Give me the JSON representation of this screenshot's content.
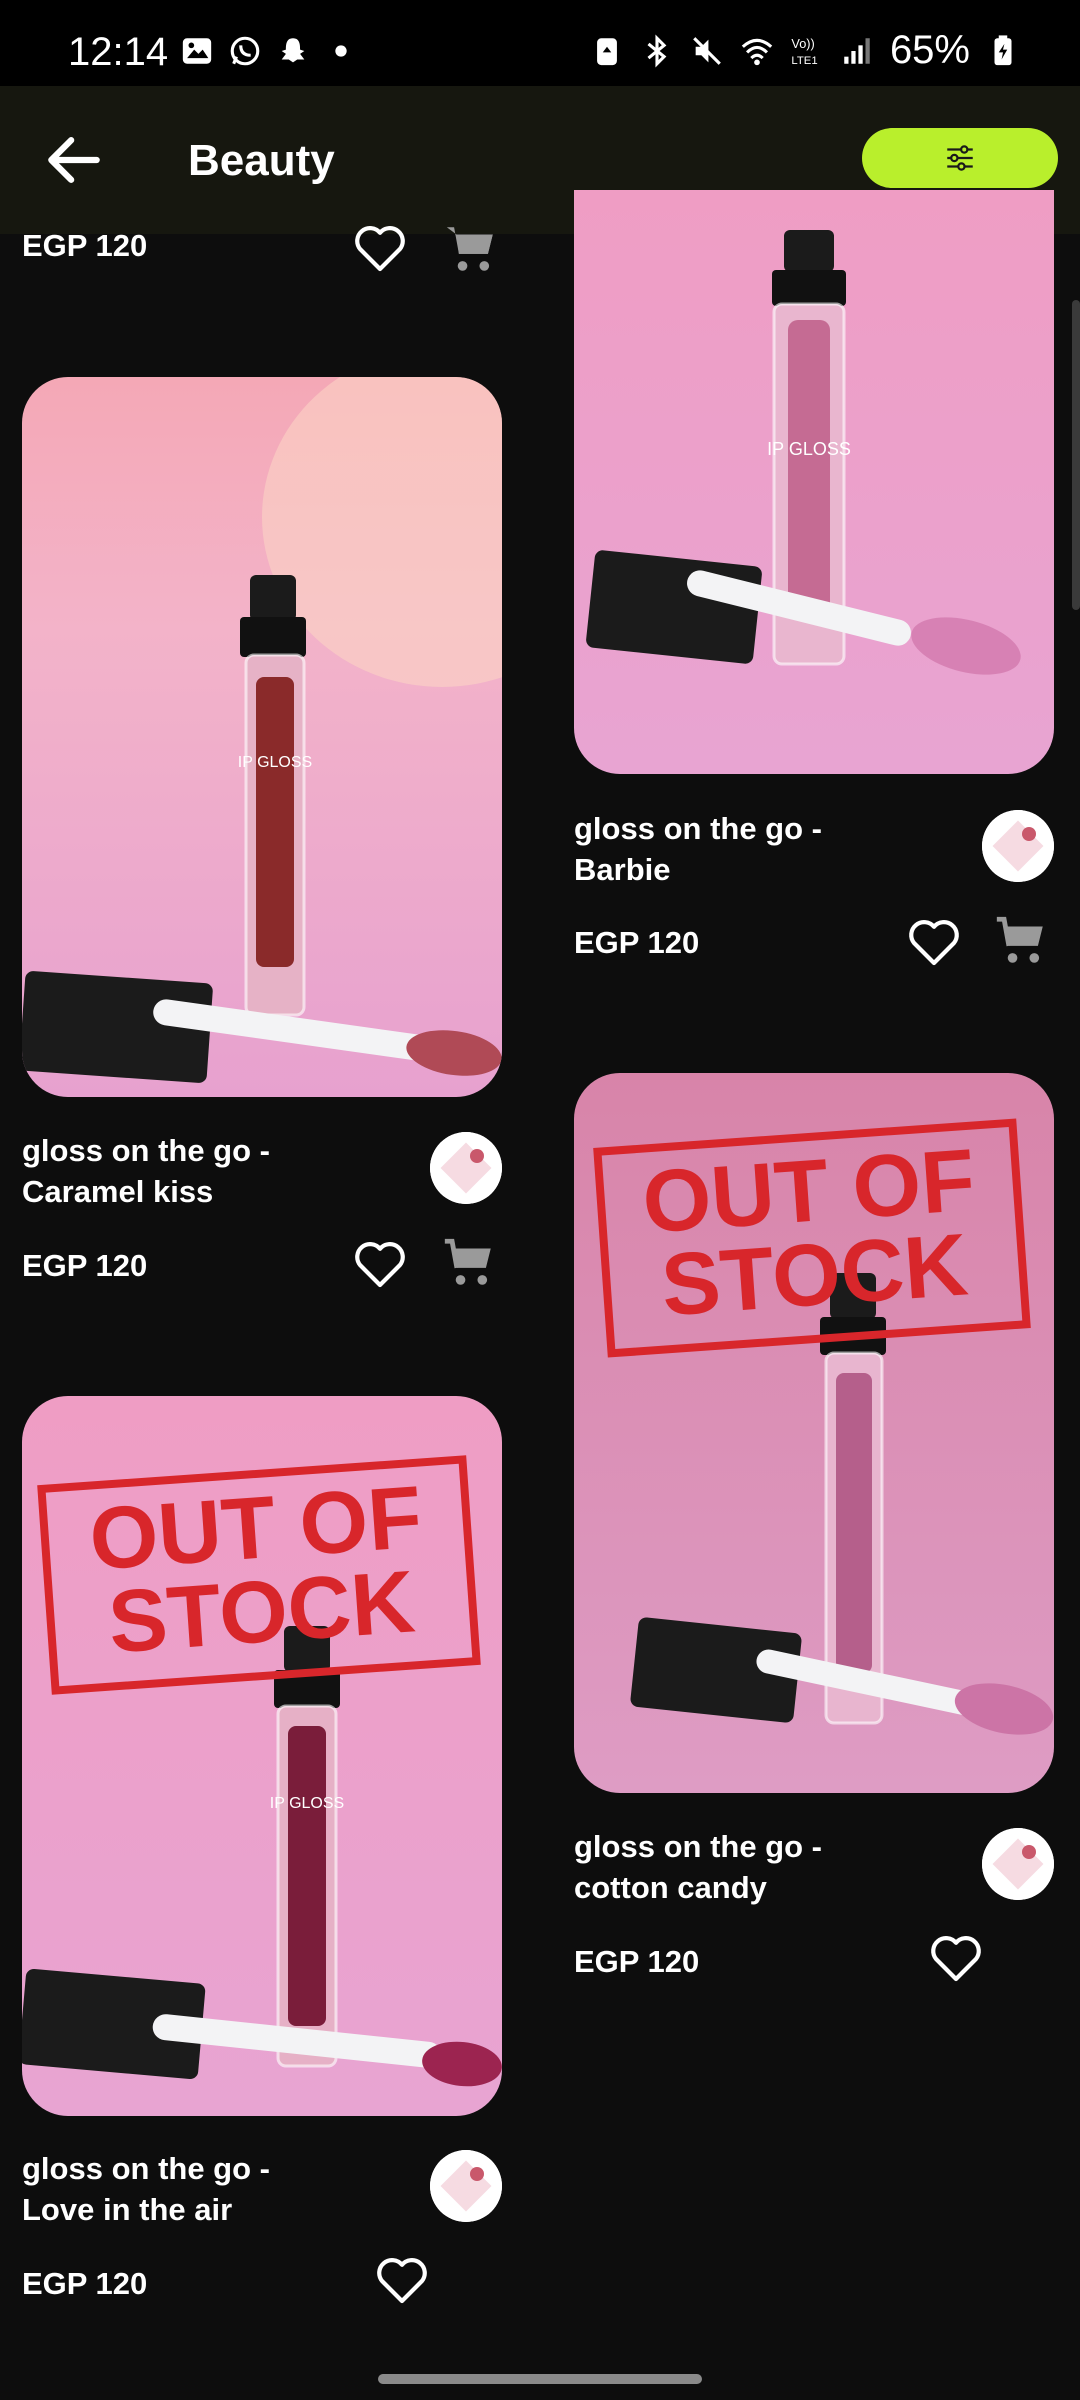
{
  "status_bar": {
    "time": "12:14",
    "left_icons": [
      "gallery-icon",
      "whatsapp-icon",
      "snapchat-icon",
      "dot-icon"
    ],
    "right_icons": [
      "battery-saver-icon",
      "bluetooth-icon",
      "mute-icon",
      "wifi-icon",
      "volte-icon",
      "signal-icon"
    ],
    "volte_label": "Vo))\nLTE1",
    "battery": "65%"
  },
  "app_bar": {
    "title": "Beauty",
    "back_icon": "arrow-left-icon",
    "filter_icon": "sliders-icon",
    "accent": "#b9ef2c"
  },
  "products": [
    {
      "name_line1": "",
      "name_line2": "",
      "price": "EGP 120",
      "has_cart": true,
      "out_of_stock": false
    },
    {
      "name_line1": "gloss on the go -",
      "name_line2": "Barbie",
      "price": "EGP 120",
      "has_cart": true,
      "out_of_stock": false
    },
    {
      "name_line1": "gloss on the go -",
      "name_line2": "Caramel kiss",
      "price": "EGP 120",
      "has_cart": true,
      "out_of_stock": false
    },
    {
      "name_line1": "gloss on the go -",
      "name_line2": "cotton candy",
      "price": "EGP 120",
      "has_cart": false,
      "out_of_stock": true
    },
    {
      "name_line1": "gloss on the go -",
      "name_line2": "Love in the air",
      "price": "EGP 120",
      "has_cart": false,
      "out_of_stock": true
    }
  ],
  "out_of_stock_label": {
    "line1": "OUT OF",
    "line2": "STOCK"
  },
  "product_image_text": "IP GLOSS",
  "colors": {
    "out_of_stock_red": "#d8262b",
    "background": "#0d0d0d"
  }
}
